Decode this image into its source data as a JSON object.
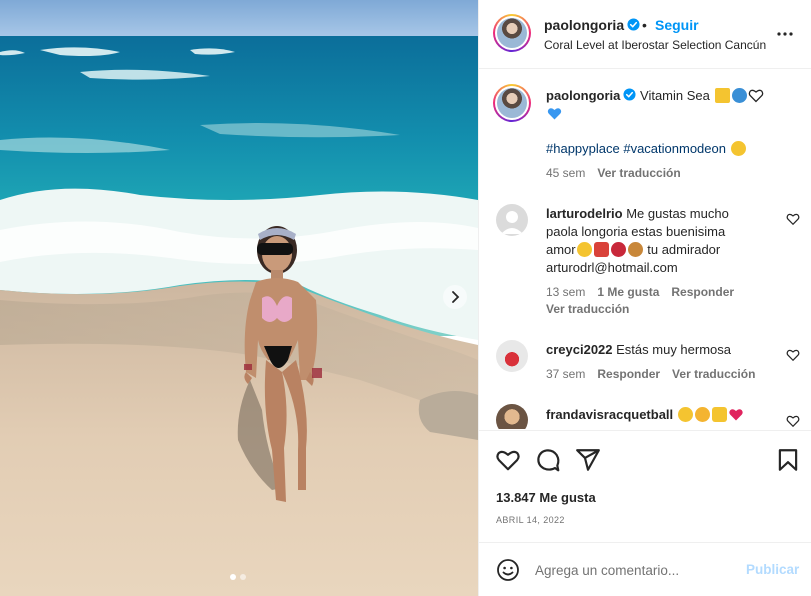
{
  "post": {
    "author": "paolongoria",
    "follow_label": "Seguir",
    "separator": "•",
    "location": "Coral Level at Iberostar Selection Cancún",
    "caption": {
      "text": "Vitamin Sea",
      "hashtags": "#happyplace #vacationmodeon",
      "time": "45 sem",
      "see_translation": "Ver traducción"
    },
    "likes": "13.847 Me gusta",
    "date": "ABRIL 14, 2022"
  },
  "comments": [
    {
      "user": "larturodelrio",
      "line1": "Me gustas mucho",
      "line2": "paola longoria estas buenisima",
      "line3_a": "amor",
      "line3_b": "tu admirador",
      "line4": "arturodrl@hotmail.com",
      "time": "13 sem",
      "likes": "1 Me gusta",
      "reply": "Responder",
      "see_translation": "Ver traducción"
    },
    {
      "user": "creyci2022",
      "text": "Estás muy hermosa",
      "time": "37 sem",
      "reply": "Responder",
      "see_translation": "Ver traducción"
    },
    {
      "user": "frandavisracquetball",
      "text": ""
    }
  ],
  "add_comment": {
    "placeholder": "Agrega un comentario...",
    "publish_label": "Publicar"
  },
  "carousel": {
    "current": 1,
    "total": 2
  },
  "colors": {
    "link_blue": "#0095f6",
    "publish_disabled": "#b3dbff",
    "muted": "#737373",
    "text": "#262626",
    "hashtag": "#00376b",
    "verified": "#0095f6"
  },
  "icons": {
    "more": "more-horizontal-icon",
    "heart": "heart-icon",
    "comment": "comment-icon",
    "share": "share-icon",
    "save": "bookmark-icon",
    "emoji": "emoji-icon",
    "next": "chevron-right-icon",
    "verified": "verified-badge-icon"
  }
}
